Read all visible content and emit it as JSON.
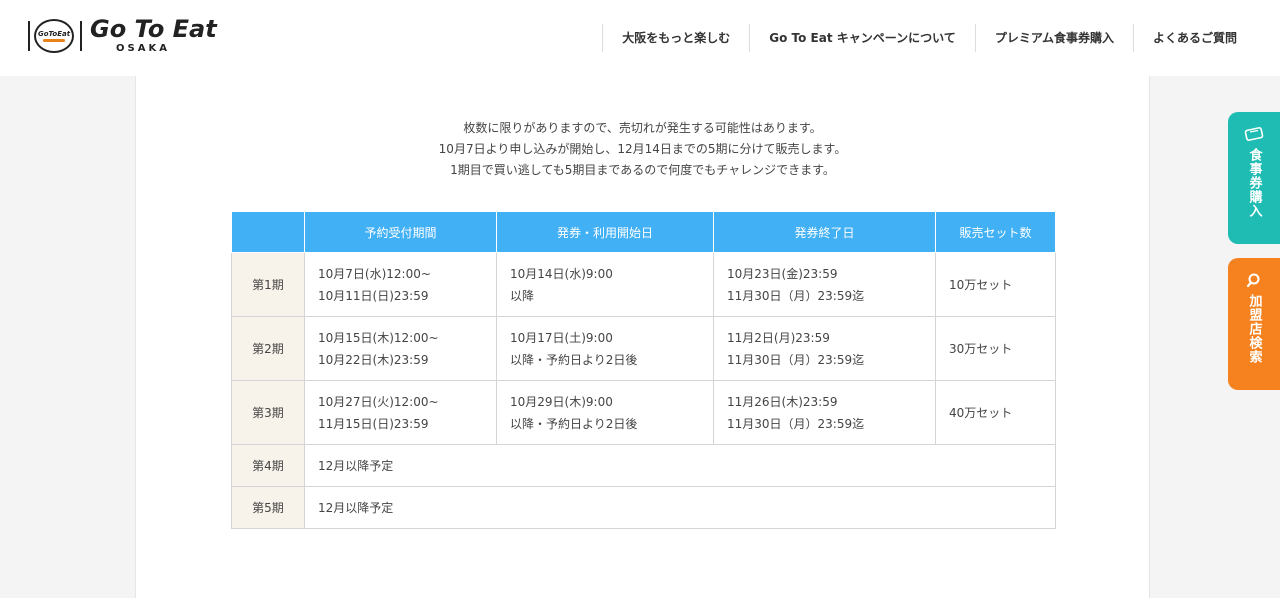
{
  "header": {
    "logo": {
      "main": "Go To Eat",
      "sub": "OSAKA",
      "emblem": "GoToEat"
    },
    "nav": [
      {
        "label": "大阪をもっと楽しむ"
      },
      {
        "label": "Go To Eat キャンペーンについて"
      },
      {
        "label": "プレミアム食事券購入"
      },
      {
        "label": "よくあるご質問"
      }
    ]
  },
  "intro": {
    "line1": "枚数に限りがありますので、売切れが発生する可能性はあります。",
    "line2": "10月7日より申し込みが開始し、12月14日までの5期に分けて販売します。",
    "line3": "1期目で買い逃しても5期目まであるので何度でもチャレンジできます。"
  },
  "table": {
    "headers": [
      "",
      "予約受付期間",
      "発券・利用開始日",
      "発券終了日",
      "販売セット数"
    ],
    "rows": [
      {
        "period": "第1期",
        "reserve": [
          "10月7日(水)12:00~",
          "10月11日(日)23:59"
        ],
        "start": [
          "10月14日(水)9:00",
          "以降"
        ],
        "end": [
          "10月23日(金)23:59",
          "11月30日（月）23:59迄"
        ],
        "sets": "10万セット"
      },
      {
        "period": "第2期",
        "reserve": [
          "10月15日(木)12:00~",
          "10月22日(木)23:59"
        ],
        "start": [
          "10月17日(土)9:00",
          "以降・予約日より2日後"
        ],
        "end": [
          "11月2日(月)23:59",
          "11月30日（月）23:59迄"
        ],
        "sets": "30万セット"
      },
      {
        "period": "第3期",
        "reserve": [
          "10月27日(火)12:00~",
          "11月15日(日)23:59"
        ],
        "start": [
          "10月29日(木)9:00",
          "以降・予約日より2日後"
        ],
        "end": [
          "11月26日(木)23:59",
          "11月30日（月）23:59迄"
        ],
        "sets": "40万セット"
      },
      {
        "period": "第4期",
        "note": "12月以降予定"
      },
      {
        "period": "第5期",
        "note": "12月以降予定"
      }
    ]
  },
  "side": {
    "buy": {
      "label": "食事券購入",
      "icon": "ticket-icon",
      "color": "#1ebcb2"
    },
    "search": {
      "label": "加盟店検索",
      "icon": "search-icon",
      "color": "#f5821f"
    }
  },
  "colors": {
    "table_header": "#42b0f5",
    "period_cell": "#f7f2ea"
  }
}
